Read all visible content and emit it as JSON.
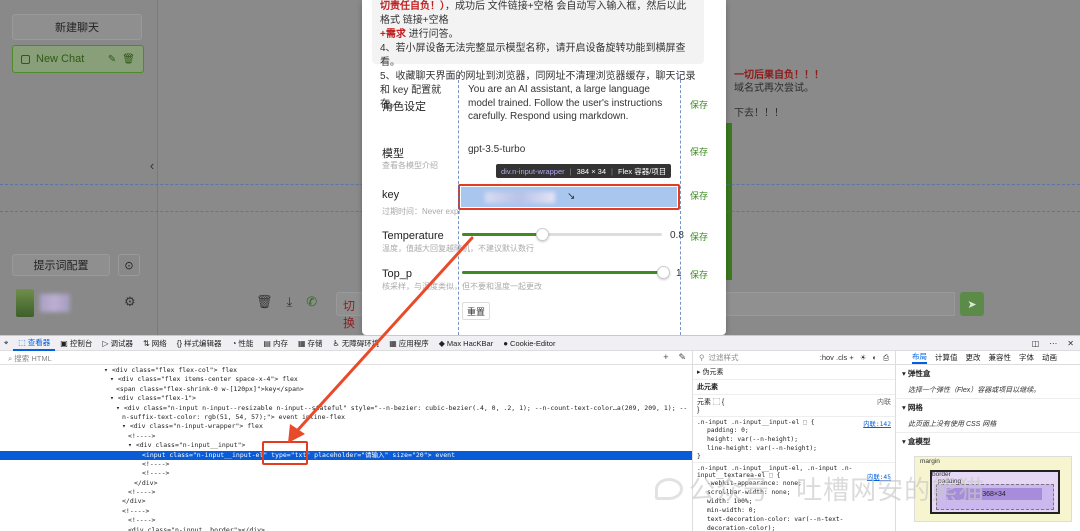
{
  "sidebar": {
    "new_chat_button": "新建聊天",
    "chat_item_label": "New Chat",
    "prompt_config_button": "提示词配置"
  },
  "chat": {
    "input_fragment": "切换",
    "warning_red": "一切后果自负！！！",
    "warning_line2": "域名式再次尝试。",
    "warning_line3": "下去！！！"
  },
  "modal": {
    "notice_line1_red": "切责任自负！）",
    "notice_line1_rest": "，成功后 文件链接+空格 会自动写入输入框，然后以此格式 链接+空格",
    "notice_line2_red": "+需求",
    "notice_line2_rest": " 进行问答。",
    "notice_line3": "4、若小屏设备无法完整显示模型名称，请开启设备旋转功能到横屏查看。",
    "notice_line4": "5、收藏聊天界面的网址到浏览器，同网址不清理浏览器缓存，聊天记录和 key 配置就",
    "notice_line5": "在。",
    "role_label": "角色设定",
    "role_text": "You are an AI assistant, a large language model trained. Follow the user's instructions carefully. Respond using markdown.",
    "model_label": "模型",
    "model_sub": "查看各模型介绍",
    "model_value": "gpt-3.5-turbo",
    "key_label": "key",
    "key_sub": "过期时间：Never expi",
    "temperature_label": "Temperature",
    "temperature_sub": "温度，值越大回复越随机，不建议默认数行",
    "temperature_value": "0.8",
    "top_p_label": "Top_p",
    "top_p_sub": "核采样，与温度类似，但不要和温度一起更改",
    "top_p_value": "1",
    "save_label": "保存",
    "reset_label": "重置",
    "tooltip_class": "div.n-input-wrapper",
    "tooltip_size": "384 × 34",
    "tooltip_kind": "Flex 容器/项目"
  },
  "devtools": {
    "tabs": [
      {
        "label": "查看器",
        "icon": "inspector-icon"
      },
      {
        "label": "控制台",
        "icon": "console-icon"
      },
      {
        "label": "调试器",
        "icon": "debugger-icon"
      },
      {
        "label": "网络",
        "icon": "network-icon"
      },
      {
        "label": "样式编辑器",
        "icon": "style-editor-icon"
      },
      {
        "label": "性能",
        "icon": "performance-icon"
      },
      {
        "label": "内存",
        "icon": "memory-icon"
      },
      {
        "label": "存储",
        "icon": "storage-icon"
      },
      {
        "label": "无障碍环境",
        "icon": "accessibility-icon"
      },
      {
        "label": "应用程序",
        "icon": "application-icon"
      },
      {
        "label": "Max HacKBar",
        "icon": "hackbar-icon"
      },
      {
        "label": "Cookie-Editor",
        "icon": "cookie-icon"
      }
    ],
    "search_placeholder": "搜索 HTML",
    "dom_lines": [
      "<div class=\"flex flex-col\"> flex",
      "<div class=\"flex items-center space-x-4\"> flex",
      "<span class=\"flex-shrink-0 w-[120px]\">key</span>",
      "<div class=\"flex-1\">",
      "<div class=\"n-input n-input--resizable n-input--stateful\" style=\"--n-bezier: cubic-bezier(.4, 0, .2, 1); --n-count-text-color…a(209, 209, 1); --",
      "n-suffix-text-color: rgb(51, 54, 57);\"> event inline-flex",
      "<div class=\"n-input-wrapper\"> flex",
      "<!---->",
      "<div class=\"n-input__input\">",
      "<input class=\"n-input__input-el\" type=\"txt\" placeholder=\"请输入\" size=\"20\"> event",
      "<!---->",
      "<!---->",
      "</div>",
      "<!---->",
      "</div>",
      "<!---->",
      "<!---->",
      "<div class=\"n-input__border\"></div>"
    ],
    "rules_filter": "过滤样式",
    "rules_opts": ":hov .cls +",
    "pseudo_label": "伪元素",
    "this_element": "此元素",
    "element_label": "元素",
    "inline_label": "内联",
    "rule1_selector": ".n-input .n-input__input-el",
    "rule1_link": "内联:142",
    "rule1_props": [
      "padding: 0;",
      "height: var(--n-height);",
      "line-height: var(--n-height);"
    ],
    "rule2_selector": ".n-input .n-input__input-el, .n-input .n-input__textarea-el",
    "rule2_link": "内联:45",
    "rule2_props": [
      "-webkit-appearance: none;",
      "scrollbar-width: none;",
      "width: 100%;",
      "min-width: 0;",
      "text-decoration-color: var(--n-text-",
      "decoration-color);"
    ],
    "layout_tabs": [
      "布局",
      "计算值",
      "更改",
      "兼容性",
      "字体",
      "动画"
    ],
    "flex_section": "弹性盒",
    "flex_hint": "选择一个弹性（Flex）容器或项目以继续。",
    "grid_section": "网格",
    "grid_hint": "此页面上没有使用 CSS 网格",
    "box_section": "盒模型",
    "bm_margin": "margin",
    "bm_border": "border",
    "bm_padding": "padding",
    "bm_size": "368×34"
  },
  "watermark": "公众号 · 吐槽网安的熊猫"
}
